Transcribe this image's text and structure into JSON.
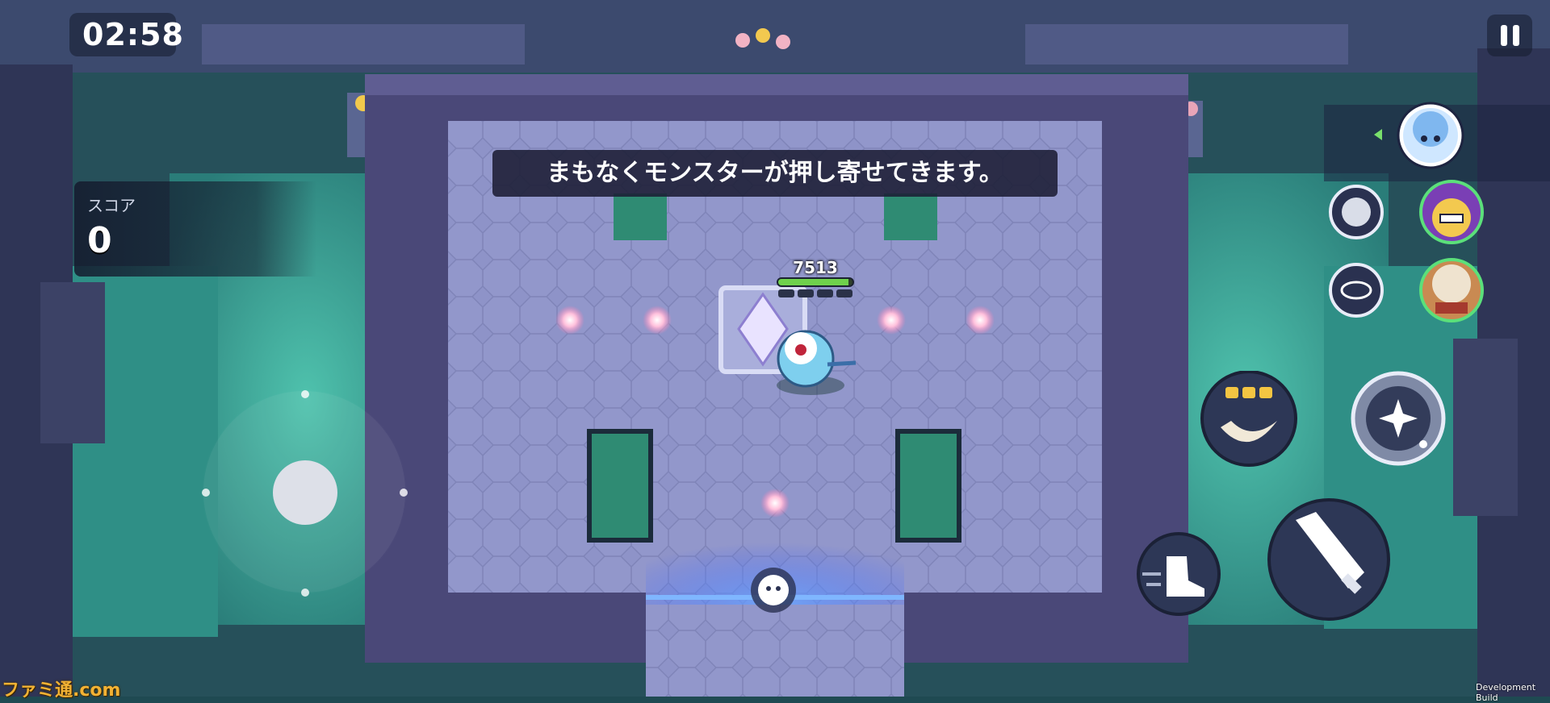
{
  "hud": {
    "timer": "02:58",
    "score_label": "スコア",
    "score_value": "0",
    "announcement": "まもなくモンスターが押し寄せてきます。",
    "player_hp": "7513",
    "player_hp_fraction": 0.95,
    "dev_label": "Development Build",
    "watermark": "ファミ通.com"
  },
  "party": {
    "members": [
      "cloud-cookie-portrait-icon",
      "clown-cookie-portrait-icon",
      "warrior-cookie-portrait-icon"
    ],
    "support_skills": [
      "cloud-swirl-skill-icon",
      "spark-ring-skill-icon"
    ]
  },
  "controls": {
    "skill_1_charges": 3,
    "icons": [
      "move-joystick",
      "swirl-skill-icon",
      "star-ultimate-icon",
      "dash-boot-icon",
      "sword-attack-icon",
      "pause-icon"
    ]
  },
  "colors": {
    "floor": "#8f94c9",
    "wall": "#4b4a7a",
    "water": "#3fa99a",
    "hp_green": "#6fd14c",
    "accent_gold": "#f4c542"
  }
}
